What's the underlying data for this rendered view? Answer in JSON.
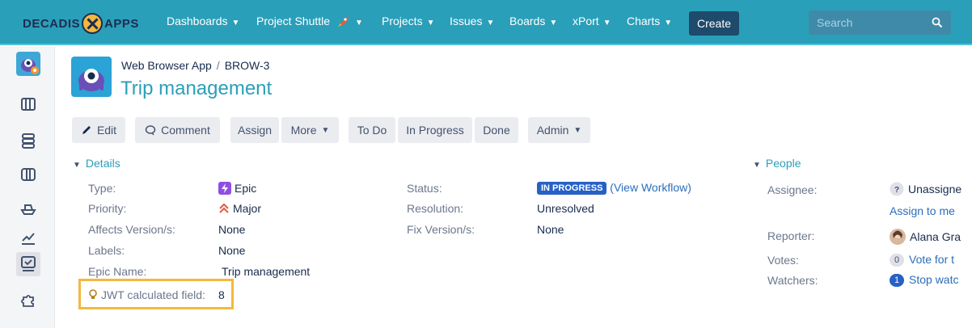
{
  "nav": {
    "logo_left": "DECADIS",
    "logo_right": "APPS",
    "items": [
      {
        "label": "Dashboards"
      },
      {
        "label": "Project Shuttle"
      },
      {
        "label": "Projects"
      },
      {
        "label": "Issues"
      },
      {
        "label": "Boards"
      },
      {
        "label": "xPort"
      },
      {
        "label": "Charts"
      }
    ],
    "create_label": "Create",
    "search_placeholder": "Search"
  },
  "breadcrumb": {
    "project": "Web Browser App",
    "separator": "/",
    "issue_key": "BROW-3"
  },
  "title": "Trip management",
  "toolbar": {
    "edit": "Edit",
    "comment": "Comment",
    "assign": "Assign",
    "more": "More",
    "todo": "To Do",
    "in_progress": "In Progress",
    "done": "Done",
    "admin": "Admin"
  },
  "details": {
    "heading": "Details",
    "type_label": "Type:",
    "type_value": "Epic",
    "priority_label": "Priority:",
    "priority_value": "Major",
    "affects_label": "Affects Version/s:",
    "affects_value": "None",
    "labels_label": "Labels:",
    "labels_value": "None",
    "epic_name_label": "Epic Name:",
    "epic_name_value": "Trip management",
    "jwt_label": "JWT calculated field:",
    "jwt_value": "8",
    "status_label": "Status:",
    "status_value": "IN PROGRESS",
    "status_link": "(View Workflow)",
    "resolution_label": "Resolution:",
    "resolution_value": "Unresolved",
    "fix_label": "Fix Version/s:",
    "fix_value": "None"
  },
  "people": {
    "heading": "People",
    "assignee_label": "Assignee:",
    "assignee_value": "Unassigne",
    "assign_to_me": "Assign to me",
    "reporter_label": "Reporter:",
    "reporter_value": "Alana Gra",
    "votes_label": "Votes:",
    "votes_count": "0",
    "votes_link": "Vote for t",
    "watchers_label": "Watchers:",
    "watchers_count": "1",
    "watchers_link": "Stop watc"
  },
  "colors": {
    "nav_bg": "#2a9fb9",
    "accent": "#2a9fb9",
    "highlight": "#f4b83f",
    "lozenge": "#2761c4",
    "epic": "#904ee2"
  }
}
